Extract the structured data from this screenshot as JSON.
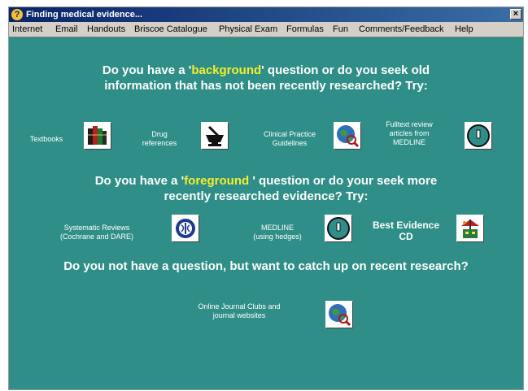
{
  "window": {
    "title": "Finding medical evidence...",
    "close_label": "×"
  },
  "menu": [
    "Internet",
    "Email",
    "Handouts",
    "Briscoe Catalogue",
    "Physical Exam",
    "Formulas",
    "Fun",
    "Comments/Feedback",
    "Help"
  ],
  "sections": {
    "background": {
      "line1_pre": "Do you have a '",
      "keyword": "background",
      "line1_post": "' question  or do you seek old",
      "line2": "information that has not been recently researched? Try:"
    },
    "foreground": {
      "line1_pre": "Do you have a  '",
      "keyword": "foreground",
      "line1_post": " ' question or do your seek more",
      "line2": "recently researched evidence?  Try:"
    },
    "catchup": {
      "line1": "Do you not have a question, but want to catch up on recent research?"
    }
  },
  "resources": {
    "textbooks": "Textbooks",
    "drug_line1": "Drug",
    "drug_line2": "references",
    "cpg_line1": "Clinical Practice",
    "cpg_line2": "Guidelines",
    "fulltext_line1": "Fulltext review",
    "fulltext_line2": "articles from",
    "fulltext_line3": "MEDLINE",
    "sysrev_line1": "Systematic Reviews",
    "sysrev_line2": "(Cochrane and DARE)",
    "medline_line1": "MEDLINE",
    "medline_line2": "(using hedges)",
    "bestev_line1": "Best Evidence",
    "bestev_line2": "CD",
    "ojc_line1": "Online Journal Clubs and",
    "ojc_line2": "journal websites"
  },
  "colors": {
    "background": "#2f8f88",
    "highlight": "#f5ee2a",
    "text": "#ffffff"
  }
}
